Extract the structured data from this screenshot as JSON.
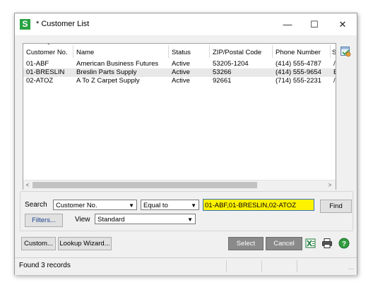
{
  "window": {
    "app_icon_letter": "S",
    "title": "* Customer List",
    "minimize_glyph": "—",
    "maximize_glyph": "☐",
    "close_glyph": "✕"
  },
  "grid": {
    "columns": [
      "Customer No.",
      "Name",
      "Status",
      "ZIP/Postal Code",
      "Phone Number",
      "S"
    ],
    "rows": [
      {
        "customer_no": "01-ABF",
        "name": "American Business Futures",
        "status": "Active",
        "zip": "53205-1204",
        "phone": "(414) 555-4787",
        "extra": "/",
        "selected": false
      },
      {
        "customer_no": "01-BRESLIN",
        "name": "Breslin Parts Supply",
        "status": "Active",
        "zip": "53266",
        "phone": "(414) 555-9654",
        "extra": "B",
        "selected": true
      },
      {
        "customer_no": "02-ATOZ",
        "name": "A To Z Carpet Supply",
        "status": "Active",
        "zip": "92661",
        "phone": "(714) 555-2231",
        "extra": "/",
        "selected": false
      }
    ],
    "scroll_left_glyph": "<",
    "scroll_right_glyph": ">"
  },
  "filter": {
    "search_label": "Search",
    "search_field": "Customer No.",
    "operator": "Equal to",
    "search_value": "01-ABF,01-BRESLIN,02-ATOZ",
    "find_label": "Find",
    "filters_label": "Filters...",
    "view_label": "View",
    "view_value": "Standard"
  },
  "buttons": {
    "custom": "Custom...",
    "lookup_wizard": "Lookup Wizard...",
    "select": "Select",
    "cancel": "Cancel"
  },
  "status": {
    "text": "Found 3 records"
  },
  "colors": {
    "app_icon": "#27a243",
    "search_highlight": "#fff200"
  }
}
